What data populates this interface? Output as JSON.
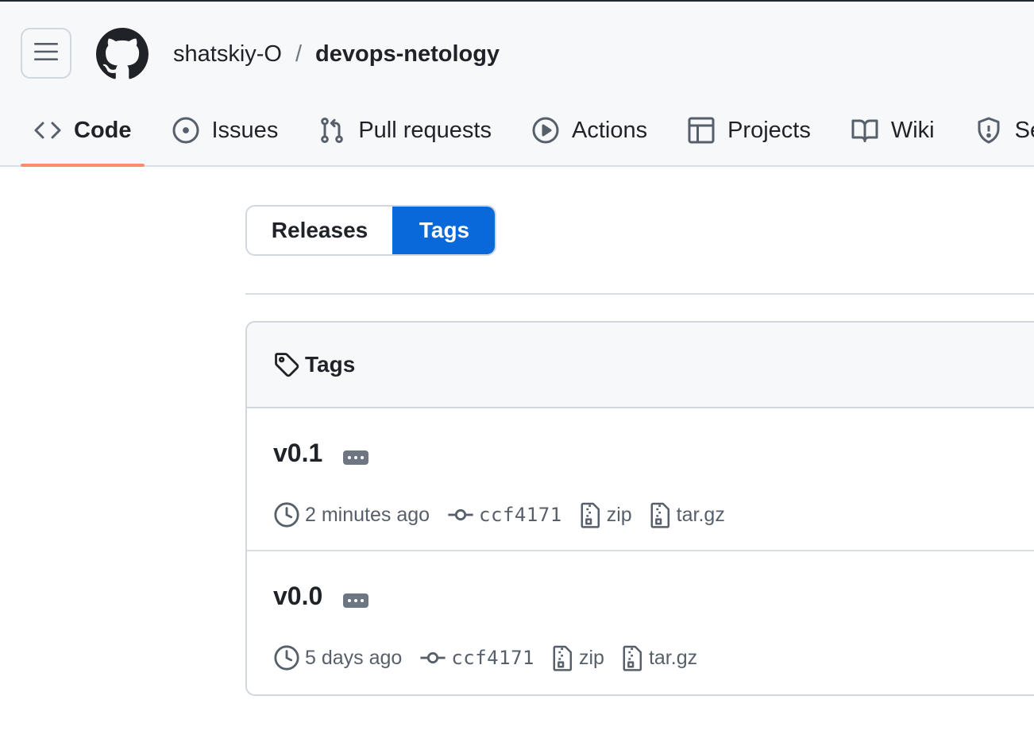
{
  "header": {
    "owner": "shatskiy-O",
    "separator": "/",
    "repo": "devops-netology"
  },
  "nav": {
    "tabs": [
      {
        "label": "Code",
        "icon": "code-icon",
        "active": true
      },
      {
        "label": "Issues",
        "icon": "issue-opened-icon"
      },
      {
        "label": "Pull requests",
        "icon": "git-pull-request-icon"
      },
      {
        "label": "Actions",
        "icon": "play-icon"
      },
      {
        "label": "Projects",
        "icon": "table-icon"
      },
      {
        "label": "Wiki",
        "icon": "book-icon"
      },
      {
        "label": "Se",
        "icon": "shield-icon"
      }
    ]
  },
  "switcher": {
    "releases_label": "Releases",
    "tags_label": "Tags",
    "selected": "Tags"
  },
  "tags_box": {
    "title": "Tags",
    "icon": "tag-icon",
    "items": [
      {
        "name": "v0.1",
        "time": "2 minutes ago",
        "commit": "ccf4171",
        "zip": "zip",
        "targz": "tar.gz"
      },
      {
        "name": "v0.0",
        "time": "5 days ago",
        "commit": "ccf4171",
        "zip": "zip",
        "targz": "tar.gz"
      }
    ]
  },
  "colors": {
    "accent": "#0969da",
    "active_tab_underline": "#fd8c73",
    "header_bg": "#f6f8fa",
    "border": "#d0d7de",
    "muted_text": "#57606a"
  }
}
